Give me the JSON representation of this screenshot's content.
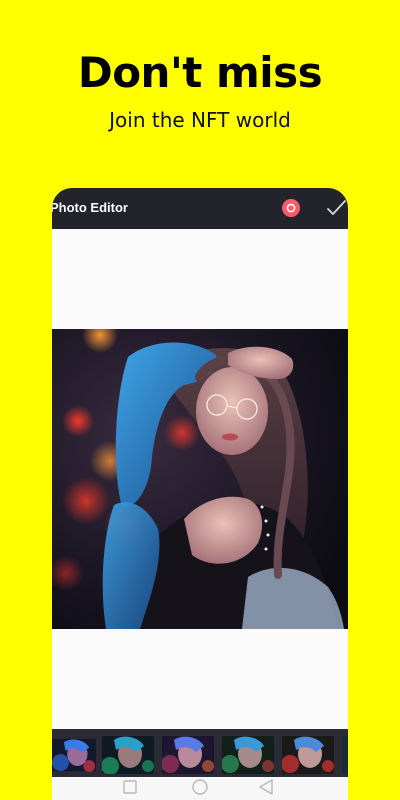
{
  "headline": "Don't miss",
  "subline": "Join the NFT world",
  "app": {
    "title": "Photo Editor",
    "reset_icon": "reset-circle-icon",
    "confirm_icon": "checkmark-icon"
  },
  "colors": {
    "background": "#FFFF00",
    "appbar": "#22232b",
    "reset": "#ff5a6b",
    "strip": "#2a2b34"
  },
  "filters": [
    "filter-1",
    "filter-2",
    "filter-3",
    "filter-4",
    "filter-5",
    "filter-6"
  ],
  "navbar": {
    "items": [
      "recent-apps-icon",
      "home-icon",
      "back-icon"
    ]
  }
}
